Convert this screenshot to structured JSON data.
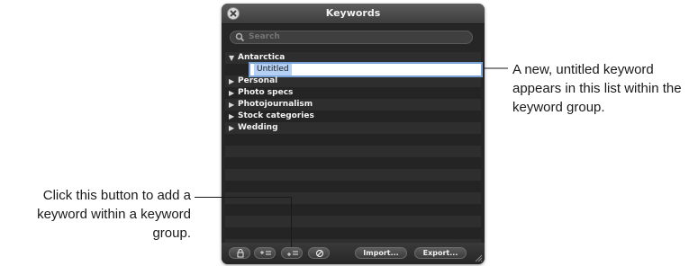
{
  "window": {
    "title": "Keywords"
  },
  "search": {
    "placeholder": "Search"
  },
  "keyword_groups": [
    {
      "label": "Antarctica",
      "expanded": true,
      "children": [
        {
          "label": "Untitled",
          "editing": true
        }
      ]
    },
    {
      "label": "Personal",
      "expanded": false
    },
    {
      "label": "Photo specs",
      "expanded": false
    },
    {
      "label": "Photojournalism",
      "expanded": false
    },
    {
      "label": "Stock categories",
      "expanded": false
    },
    {
      "label": "Wedding",
      "expanded": false
    }
  ],
  "toolbar": {
    "import_label": "Import...",
    "export_label": "Export..."
  },
  "callouts": {
    "right": "A new, untitled keyword appears in this list within the keyword group.",
    "left": "Click this button to add a keyword within a keyword group."
  },
  "icons": {
    "close": "close-icon",
    "search": "search-icon",
    "disclosure_open": "triangle-down-icon",
    "disclosure_closed": "triangle-right-icon",
    "lock": "lock-icon",
    "add_group": "add-keyword-group-icon",
    "add_keyword": "add-keyword-icon",
    "remove": "remove-icon"
  },
  "colors": {
    "selection_outline": "#7aa2d6",
    "panel_bg": "#262626"
  }
}
